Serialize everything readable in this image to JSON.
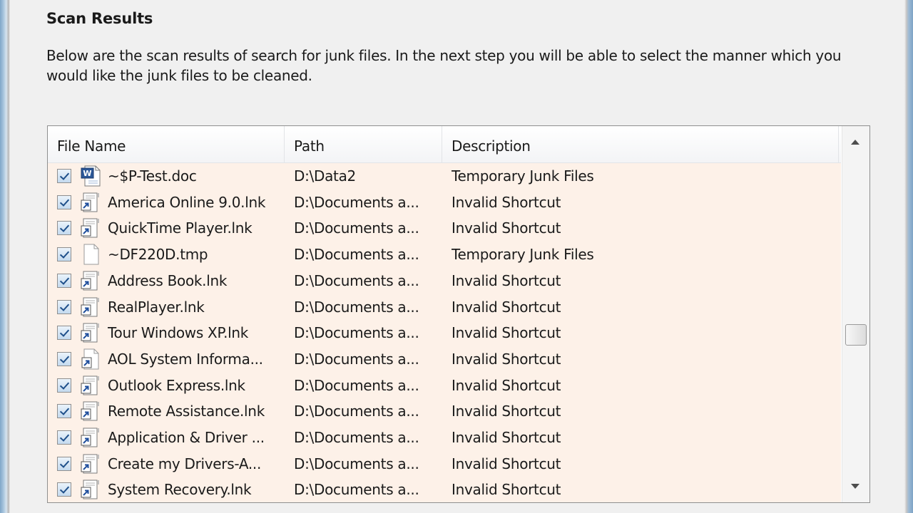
{
  "section": {
    "heading": "Scan Results",
    "description": "Below are the scan results of search for junk files. In the next step you will be able to select the manner which you would like the junk files to be cleaned."
  },
  "list": {
    "columns": [
      "File Name",
      "Path",
      "Description"
    ],
    "rows": [
      {
        "checked": true,
        "icon": "word-doc-icon",
        "name": "~$P-Test.doc",
        "path": "D:\\Data2",
        "description": "Temporary Junk Files"
      },
      {
        "checked": true,
        "icon": "shortcut-icon",
        "name": "America Online 9.0.lnk",
        "path": "D:\\Documents a...",
        "description": "Invalid Shortcut"
      },
      {
        "checked": true,
        "icon": "shortcut-icon",
        "name": "QuickTime Player.lnk",
        "path": "D:\\Documents a...",
        "description": "Invalid Shortcut"
      },
      {
        "checked": true,
        "icon": "blank-file-icon",
        "name": "~DF220D.tmp",
        "path": "D:\\Documents a...",
        "description": "Temporary Junk Files"
      },
      {
        "checked": true,
        "icon": "shortcut-icon",
        "name": "Address Book.lnk",
        "path": "D:\\Documents a...",
        "description": "Invalid Shortcut"
      },
      {
        "checked": true,
        "icon": "shortcut-icon",
        "name": "RealPlayer.lnk",
        "path": "D:\\Documents a...",
        "description": "Invalid Shortcut"
      },
      {
        "checked": true,
        "icon": "shortcut-icon",
        "name": "Tour Windows XP.lnk",
        "path": "D:\\Documents a...",
        "description": "Invalid Shortcut"
      },
      {
        "checked": true,
        "icon": "blank-shortcut-icon",
        "name": "AOL System Informa...",
        "path": "D:\\Documents a...",
        "description": "Invalid Shortcut"
      },
      {
        "checked": true,
        "icon": "shortcut-icon",
        "name": "Outlook Express.lnk",
        "path": "D:\\Documents a...",
        "description": "Invalid Shortcut"
      },
      {
        "checked": true,
        "icon": "shortcut-icon",
        "name": "Remote Assistance.lnk",
        "path": "D:\\Documents a...",
        "description": "Invalid Shortcut"
      },
      {
        "checked": true,
        "icon": "shortcut-icon",
        "name": "Application & Driver ...",
        "path": "D:\\Documents a...",
        "description": "Invalid Shortcut"
      },
      {
        "checked": true,
        "icon": "shortcut-icon",
        "name": "Create my Drivers-A...",
        "path": "D:\\Documents a...",
        "description": "Invalid Shortcut"
      },
      {
        "checked": true,
        "icon": "shortcut-icon",
        "name": "System Recovery.lnk",
        "path": "D:\\Documents a...",
        "description": "Invalid Shortcut"
      }
    ]
  }
}
